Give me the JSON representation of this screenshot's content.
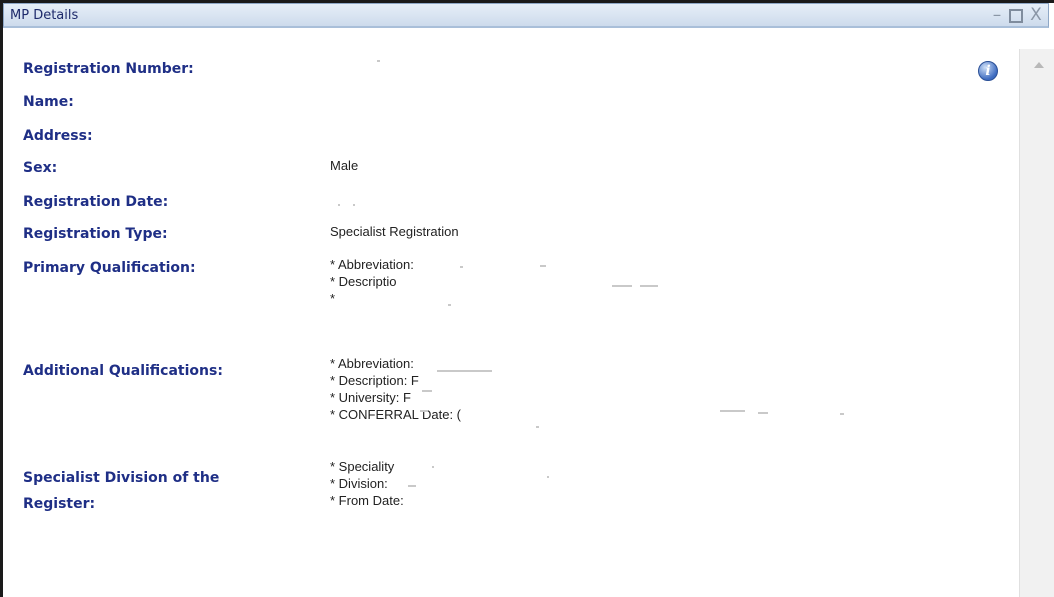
{
  "window": {
    "title": "MP Details",
    "buttons": {
      "minimize": "–",
      "close": "X"
    }
  },
  "details": {
    "registration_number": {
      "label": "Registration Number:"
    },
    "name": {
      "label": "Name:"
    },
    "address": {
      "label": "Address:"
    },
    "sex": {
      "label": "Sex:",
      "value": "Male"
    },
    "registration_date": {
      "label": "Registration Date:"
    },
    "registration_type": {
      "label": "Registration Type:",
      "value": "Specialist Registration"
    },
    "primary_qualification": {
      "label": "Primary Qualification:",
      "lines": [
        "* Abbreviation:",
        "* Descriptio",
        "*"
      ]
    },
    "additional_qualifications": {
      "label": "Additional Qualifications:",
      "lines": [
        "* Abbreviation:",
        "* Description: F",
        "* University: F",
        "* CONFERRAL Date: ("
      ]
    },
    "specialist_division": {
      "label_line1": "Specialist Division of the",
      "label_line2": "Register:",
      "lines": [
        "* Speciality",
        "* Division:",
        "* From Date:"
      ]
    }
  },
  "icons": {
    "info": "i"
  }
}
